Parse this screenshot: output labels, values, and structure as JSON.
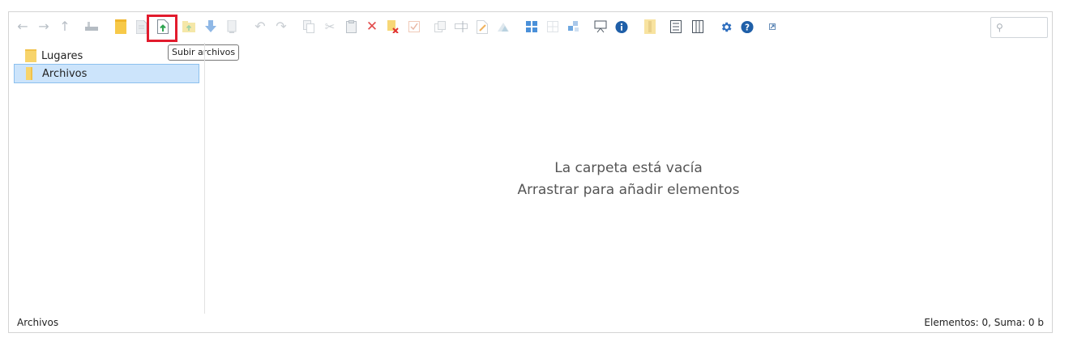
{
  "toolbar": {
    "tooltip": "Subir archivos",
    "search_placeholder": ""
  },
  "sidebar": {
    "items": [
      {
        "label": "Lugares",
        "selected": false
      },
      {
        "label": "Archivos",
        "selected": true
      }
    ]
  },
  "content": {
    "empty_line1": "La carpeta está vacía",
    "empty_line2": "Arrastrar para añadir elementos"
  },
  "statusbar": {
    "path": "Archivos",
    "summary": "Elementos: 0, Suma: 0 b"
  },
  "colors": {
    "highlight_box": "#e21b2d",
    "selection_bg": "#cce4fb",
    "accent_blue": "#2f7fd6",
    "folder_yellow": "#f7c948"
  }
}
